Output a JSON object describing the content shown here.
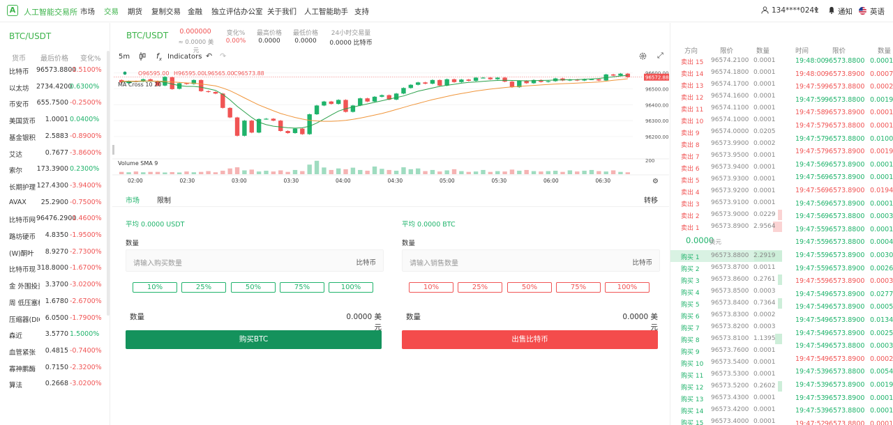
{
  "nav": {
    "logo_glyph": "A",
    "brand": "人工智能交易所",
    "items": [
      "市场",
      "交易",
      "期货",
      "复制交易",
      "金融",
      "独立评估办公室",
      "关于我们",
      "人工智能助手",
      "支持"
    ],
    "active_index": 1,
    "user": "134****0241",
    "notify": "通知",
    "lang": "英语"
  },
  "market": {
    "title": "BTC/USDT",
    "headers": [
      "货币",
      "最后价格",
      "变化%"
    ],
    "rows": [
      {
        "name": "比特币",
        "price": "96573.8800",
        "change": "-1.5100%",
        "dir": "down"
      },
      {
        "name": "以太坊",
        "price": "2734.4200",
        "change": "0.6300%",
        "dir": "up"
      },
      {
        "name": "币安币",
        "price": "655.7500",
        "change": "-0.2500%",
        "dir": "down"
      },
      {
        "name": "美国货币",
        "price": "1.0001",
        "change": "0.0400%",
        "dir": "up"
      },
      {
        "name": "基金银积",
        "price": "2.5883",
        "change": "-0.8900%",
        "dir": "down"
      },
      {
        "name": "艾达",
        "price": "0.7677",
        "change": "-3.8600%",
        "dir": "down"
      },
      {
        "name": "索尔",
        "price": "173.3900",
        "change": "0.2300%",
        "dir": "up"
      },
      {
        "name": "长期护理",
        "price": "127.4300",
        "change": "-3.9400%",
        "dir": "down"
      },
      {
        "name": "AVAX",
        "price": "25.2900",
        "change": "-0.7500%",
        "dir": "down"
      },
      {
        "name": "比特币网",
        "price": "96476.2900",
        "change": "-1.4600%",
        "dir": "down"
      },
      {
        "name": "路坊硬币",
        "price": "4.8350",
        "change": "-1.9500%",
        "dir": "down"
      },
      {
        "name": "(W)酮叶",
        "price": "8.9270",
        "change": "-2.7300%",
        "dir": "down"
      },
      {
        "name": "比特币现",
        "price": "318.8000",
        "change": "-1.6700%",
        "dir": "down"
      },
      {
        "name": "金 外围投资",
        "price": "3.3700",
        "change": "-3.0200%",
        "dir": "down"
      },
      {
        "name": "周 低压塞格",
        "price": "1.6780",
        "change": "-2.6700%",
        "dir": "down"
      },
      {
        "name": "压缩器(DIO)",
        "price": "6.0500",
        "change": "-1.7900%",
        "dir": "down"
      },
      {
        "name": "森近",
        "price": "3.5770",
        "change": "1.5000%",
        "dir": "up"
      },
      {
        "name": "血管紧张",
        "price": "0.4815",
        "change": "-0.7400%",
        "dir": "down"
      },
      {
        "name": "寡神鹏酶",
        "price": "0.7150",
        "change": "-2.3200%",
        "dir": "down"
      },
      {
        "name": "算法",
        "price": "0.2668",
        "change": "-3.0200%",
        "dir": "down"
      }
    ]
  },
  "pair": {
    "name": "BTC/USDT",
    "price": "0.000000",
    "price_sub": "≈ 0.0000 美元",
    "stats": [
      {
        "label": "变化%",
        "value": "0.00%"
      },
      {
        "label": "最高价格",
        "value": "0.0000"
      },
      {
        "label": "最低价格",
        "value": "0.0000"
      },
      {
        "label": "24小时交易量",
        "value": "0.0000 比特币"
      }
    ]
  },
  "chart_toolbar": {
    "interval": "5m",
    "indicators": "Indicators"
  },
  "chart_data": {
    "type": "candlestick",
    "ohlc_label": {
      "o": "O96595.00",
      "h": "H96595.00",
      "l": "L96565.00",
      "c": "C96573.88"
    },
    "ma_label": "MA Cross 10 20",
    "volume_label": "Volume SMA 9",
    "last_price_tag": "96572.88",
    "y_ticks": [
      "96600.00",
      "96500.00",
      "96400.00",
      "96300.00",
      "96200.00"
    ],
    "y_tick_values": [
      96600,
      96500,
      96400,
      96300,
      96200
    ],
    "vol_tick": "200",
    "x_ticks": [
      "02:00",
      "02:30",
      "03:00",
      "03:30",
      "04:00",
      "04:30",
      "05:00",
      "05:30",
      "06:00",
      "06:30"
    ],
    "ylim": [
      96130,
      96620
    ],
    "candles": [
      [
        96555,
        96540
      ],
      [
        96535,
        96548
      ],
      [
        96548,
        96545
      ],
      [
        96546,
        96560
      ],
      [
        96560,
        96548
      ],
      [
        96548,
        96520
      ],
      [
        96520,
        96575
      ],
      [
        96572,
        96498
      ],
      [
        96500,
        96535
      ],
      [
        96535,
        96530
      ],
      [
        96530,
        96555
      ],
      [
        96555,
        96485
      ],
      [
        96485,
        96480
      ],
      [
        96480,
        96470
      ],
      [
        96470,
        96380
      ],
      [
        96380,
        96320
      ],
      [
        96320,
        96205
      ],
      [
        96205,
        96300
      ],
      [
        96300,
        96225
      ],
      [
        96225,
        96310
      ],
      [
        96310,
        96312
      ],
      [
        96312,
        96300
      ],
      [
        96300,
        96235
      ],
      [
        96235,
        96222
      ],
      [
        96222,
        96250
      ],
      [
        96250,
        96215
      ],
      [
        96215,
        96340
      ],
      [
        96340,
        96395
      ],
      [
        96395,
        96420
      ],
      [
        96420,
        96405
      ],
      [
        96405,
        96430
      ],
      [
        96430,
        96355
      ],
      [
        96355,
        96395
      ],
      [
        96395,
        96440
      ],
      [
        96440,
        96420
      ],
      [
        96420,
        96450
      ],
      [
        96450,
        96460
      ],
      [
        96460,
        96432
      ],
      [
        96432,
        96470
      ],
      [
        96470,
        96505
      ],
      [
        96505,
        96525
      ],
      [
        96525,
        96540
      ],
      [
        96540,
        96532
      ],
      [
        96532,
        96555
      ],
      [
        96555,
        96520
      ],
      [
        96520,
        96560
      ],
      [
        96560,
        96542
      ],
      [
        96542,
        96558
      ],
      [
        96558,
        96550
      ],
      [
        96550,
        96570
      ],
      [
        96570,
        96570
      ],
      [
        96570,
        96560
      ],
      [
        96560,
        96570
      ],
      [
        96570,
        96545
      ],
      [
        96545,
        96510
      ],
      [
        96510,
        96550
      ],
      [
        96550,
        96535
      ],
      [
        96535,
        96555
      ],
      [
        96555,
        96543
      ],
      [
        96543,
        96548
      ],
      [
        96548,
        96565
      ],
      [
        96565,
        96552
      ],
      [
        96552,
        96558
      ],
      [
        96558,
        96552
      ],
      [
        96552,
        96560
      ],
      [
        96560,
        96560
      ],
      [
        96560,
        96552
      ],
      [
        96552,
        96590
      ],
      [
        96590,
        96583
      ],
      [
        96583,
        96595
      ],
      [
        96595,
        96573
      ]
    ],
    "ma10": [
      96545,
      96545,
      96546,
      96547,
      96548,
      96547,
      96540,
      96530,
      96520,
      96515,
      96515,
      96510,
      96500,
      96490,
      96465,
      96430,
      96390,
      96355,
      96320,
      96290,
      96275,
      96265,
      96260,
      96255,
      96253,
      96255,
      96265,
      96285,
      96310,
      96335,
      96360,
      96375,
      96385,
      96395,
      96405,
      96415,
      96425,
      96435,
      96445,
      96455,
      96470,
      96485,
      96495,
      96505,
      96515,
      96522,
      96528,
      96535,
      96540,
      96543,
      96547,
      96550,
      96552,
      96553,
      96552,
      96551,
      96550,
      96551,
      96552,
      96553,
      96555,
      96556,
      96557,
      96558,
      96560,
      96562,
      96565,
      96570,
      96575,
      96580,
      96585
    ],
    "ma20": [
      96548,
      96548,
      96548,
      96549,
      96549,
      96548,
      96546,
      96543,
      96540,
      96537,
      96535,
      96530,
      96524,
      96518,
      96505,
      96488,
      96466,
      96443,
      96420,
      96398,
      96380,
      96362,
      96345,
      96332,
      96320,
      96310,
      96302,
      96298,
      96296,
      96296,
      96298,
      96302,
      96308,
      96316,
      96325,
      96335,
      96345,
      96357,
      96370,
      96383,
      96396,
      96408,
      96420,
      96432,
      96442,
      96452,
      96462,
      96470,
      96478,
      96486,
      96492,
      96498,
      96503,
      96508,
      96512,
      96515,
      96518,
      96521,
      96524,
      96527,
      96530,
      96532,
      96534,
      96536,
      96538,
      96540,
      96543,
      96548,
      96553,
      96558,
      96563
    ],
    "volumes": [
      12,
      10,
      14,
      10,
      12,
      12,
      9,
      11,
      9,
      14,
      10,
      12,
      16,
      10,
      18,
      30,
      36,
      20,
      24,
      14,
      18,
      14,
      20,
      12,
      22,
      16,
      50,
      70,
      35,
      22,
      30,
      26,
      34,
      22,
      18,
      40,
      28,
      22,
      18,
      36,
      26,
      30,
      16,
      22,
      14,
      20,
      26,
      16,
      12,
      14,
      22,
      12,
      16,
      14,
      24,
      18,
      22,
      16,
      14,
      16,
      18,
      12,
      20,
      14,
      18,
      22,
      16,
      14,
      20,
      12,
      10
    ]
  },
  "order_form": {
    "tabs": [
      "市场",
      "限制"
    ],
    "transfer": "转移",
    "buy": {
      "avg": "平均 0.0000 USDT",
      "qty_label": "数量",
      "placeholder": "请输入购买数量",
      "unit": "比特币",
      "total_label": "数量",
      "total": "0.0000 美元",
      "button": "购买BTC"
    },
    "sell": {
      "avg": "平均 0.0000 BTC",
      "qty_label": "数量",
      "placeholder": "请输入销售数量",
      "unit": "比特币",
      "total_label": "数量",
      "total": "0.0000 美元",
      "button": "出售比特币"
    },
    "percents": [
      "10%",
      "25%",
      "50%",
      "75%",
      "100%"
    ]
  },
  "order_book": {
    "headers": [
      "方向",
      "限价",
      "数量"
    ],
    "asks": [
      {
        "side": "卖出 15",
        "price": "96574.2100",
        "qty": "0.0001",
        "depth": 0
      },
      {
        "side": "卖出 14",
        "price": "96574.1800",
        "qty": "0.0001",
        "depth": 0
      },
      {
        "side": "卖出 13",
        "price": "96574.1700",
        "qty": "0.0001",
        "depth": 0
      },
      {
        "side": "卖出 12",
        "price": "96574.1600",
        "qty": "0.0001",
        "depth": 0
      },
      {
        "side": "卖出 11",
        "price": "96574.1100",
        "qty": "0.0001",
        "depth": 0
      },
      {
        "side": "卖出 10",
        "price": "96574.1000",
        "qty": "0.0001",
        "depth": 0
      },
      {
        "side": "卖出 9",
        "price": "96574.0000",
        "qty": "0.0205",
        "depth": 0
      },
      {
        "side": "卖出 8",
        "price": "96573.9900",
        "qty": "0.0002",
        "depth": 0
      },
      {
        "side": "卖出 7",
        "price": "96573.9500",
        "qty": "0.0001",
        "depth": 0
      },
      {
        "side": "卖出 6",
        "price": "96573.9400",
        "qty": "0.0001",
        "depth": 0
      },
      {
        "side": "卖出 5",
        "price": "96573.9300",
        "qty": "0.0001",
        "depth": 0
      },
      {
        "side": "卖出 4",
        "price": "96573.9200",
        "qty": "0.0001",
        "depth": 0
      },
      {
        "side": "卖出 3",
        "price": "96573.9100",
        "qty": "0.0001",
        "depth": 0
      },
      {
        "side": "卖出 2",
        "price": "96573.9000",
        "qty": "0.0229",
        "depth": 0.06
      },
      {
        "side": "卖出 1",
        "price": "96573.8900",
        "qty": "2.9564",
        "depth": 0.33
      }
    ],
    "mid": "0.0000",
    "mid_unit": "美元",
    "bids": [
      {
        "side": "购买 1",
        "price": "96573.8800",
        "qty": "2.2919",
        "depth": 1
      },
      {
        "side": "购买 2",
        "price": "96573.8700",
        "qty": "0.0011",
        "depth": 0
      },
      {
        "side": "购买 3",
        "price": "96573.8600",
        "qty": "0.2761",
        "depth": 0.04
      },
      {
        "side": "购买 4",
        "price": "96573.8500",
        "qty": "0.0003",
        "depth": 0
      },
      {
        "side": "购买 5",
        "price": "96573.8400",
        "qty": "0.7364",
        "depth": 0.12
      },
      {
        "side": "购买 6",
        "price": "96573.8300",
        "qty": "0.0002",
        "depth": 0
      },
      {
        "side": "购买 7",
        "price": "96573.8200",
        "qty": "0.0003",
        "depth": 0
      },
      {
        "side": "购买 8",
        "price": "96573.8100",
        "qty": "1.1395",
        "depth": 0.25
      },
      {
        "side": "购买 9",
        "price": "96573.7600",
        "qty": "0.0001",
        "depth": 0
      },
      {
        "side": "购买 10",
        "price": "96573.5400",
        "qty": "0.0001",
        "depth": 0
      },
      {
        "side": "购买 11",
        "price": "96573.5300",
        "qty": "0.0001",
        "depth": 0
      },
      {
        "side": "购买 12",
        "price": "96573.5200",
        "qty": "0.2602",
        "depth": 0.04
      },
      {
        "side": "购买 13",
        "price": "96573.4300",
        "qty": "0.0001",
        "depth": 0
      },
      {
        "side": "购买 14",
        "price": "96573.4200",
        "qty": "0.0001",
        "depth": 0
      },
      {
        "side": "购买 15",
        "price": "96573.4000",
        "qty": "0.0001",
        "depth": 0
      }
    ]
  },
  "trades": {
    "headers": [
      "时间",
      "限价",
      "数量"
    ],
    "rows": [
      {
        "time": "19:48:00",
        "price": "96573.8800",
        "qty": "0.0001",
        "dir": "up"
      },
      {
        "time": "19:48:00",
        "price": "96573.8900",
        "qty": "0.0007",
        "dir": "down"
      },
      {
        "time": "19:47:59",
        "price": "96573.8800",
        "qty": "0.0002",
        "dir": "down"
      },
      {
        "time": "19:47:59",
        "price": "96573.8800",
        "qty": "0.0019",
        "dir": "up"
      },
      {
        "time": "19:47:58",
        "price": "96573.8900",
        "qty": "0.0001",
        "dir": "down"
      },
      {
        "time": "19:47:57",
        "price": "96573.8800",
        "qty": "0.0001",
        "dir": "down"
      },
      {
        "time": "19:47:57",
        "price": "96573.8800",
        "qty": "0.0100",
        "dir": "up"
      },
      {
        "time": "19:47:57",
        "price": "96573.8900",
        "qty": "0.0019",
        "dir": "down"
      },
      {
        "time": "19:47:56",
        "price": "96573.8900",
        "qty": "0.0001",
        "dir": "up"
      },
      {
        "time": "19:47:56",
        "price": "96573.8900",
        "qty": "0.0001",
        "dir": "up"
      },
      {
        "time": "19:47:56",
        "price": "96573.8900",
        "qty": "0.0194",
        "dir": "down"
      },
      {
        "time": "19:47:56",
        "price": "96573.8900",
        "qty": "0.0001",
        "dir": "up"
      },
      {
        "time": "19:47:56",
        "price": "96573.8800",
        "qty": "0.0003",
        "dir": "up"
      },
      {
        "time": "19:47:55",
        "price": "96573.8800",
        "qty": "0.0001",
        "dir": "up"
      },
      {
        "time": "19:47:55",
        "price": "96573.8800",
        "qty": "0.0004",
        "dir": "up"
      },
      {
        "time": "19:47:55",
        "price": "96573.8900",
        "qty": "0.0030",
        "dir": "up"
      },
      {
        "time": "19:47:55",
        "price": "96573.8900",
        "qty": "0.0026",
        "dir": "up"
      },
      {
        "time": "19:47:55",
        "price": "96573.8900",
        "qty": "0.0003",
        "dir": "down"
      },
      {
        "time": "19:47:54",
        "price": "96573.8900",
        "qty": "0.0277",
        "dir": "up"
      },
      {
        "time": "19:47:54",
        "price": "96573.8900",
        "qty": "0.0005",
        "dir": "up"
      },
      {
        "time": "19:47:54",
        "price": "96573.8900",
        "qty": "0.0134",
        "dir": "up"
      },
      {
        "time": "19:47:54",
        "price": "96573.8900",
        "qty": "0.0025",
        "dir": "up"
      },
      {
        "time": "19:47:54",
        "price": "96573.8800",
        "qty": "0.0003",
        "dir": "up"
      },
      {
        "time": "19:47:54",
        "price": "96573.8900",
        "qty": "0.0002",
        "dir": "down"
      },
      {
        "time": "19:47:53",
        "price": "96573.8800",
        "qty": "0.0054",
        "dir": "up"
      },
      {
        "time": "19:47:53",
        "price": "96573.8900",
        "qty": "0.0019",
        "dir": "up"
      },
      {
        "time": "19:47:53",
        "price": "96573.8900",
        "qty": "0.0001",
        "dir": "up"
      },
      {
        "time": "19:47:53",
        "price": "96573.8800",
        "qty": "0.0001",
        "dir": "up"
      },
      {
        "time": "19:47:52",
        "price": "96573.8800",
        "qty": "0.0001",
        "dir": "down"
      }
    ]
  },
  "colors": {
    "up": "#1fb36b",
    "down": "#f05454",
    "brand": "#3cb34a",
    "ma_fast": "#2aa04a",
    "ma_slow": "#f0953a"
  }
}
